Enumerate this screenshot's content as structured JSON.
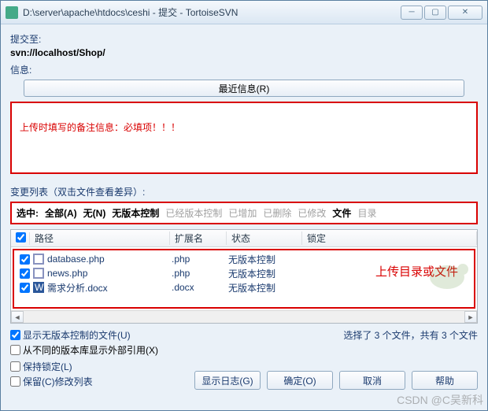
{
  "window": {
    "title": "D:\\server\\apache\\htdocs\\ceshi - 提交 - TortoiseSVN"
  },
  "commit_to_label": "提交至:",
  "commit_url": "svn://localhost/Shop/",
  "info_label": "信息:",
  "recent_button": "最近信息(R)",
  "message_annotation": "上传时填写的备注信息：必填项！！！",
  "changelist_label": "变更列表（双击文件查看差异）:",
  "filter": {
    "selected_label": "选中:",
    "all": "全部(A)",
    "none": "无(N)",
    "unversioned": "无版本控制",
    "versioned": "已经版本控制",
    "added": "已增加",
    "deleted": "已删除",
    "modified": "已修改",
    "files": "文件",
    "dirs": "目录"
  },
  "columns": {
    "path": "路径",
    "ext": "扩展名",
    "status": "状态",
    "lock": "锁定"
  },
  "rows": [
    {
      "checked": true,
      "icon": "php",
      "name": "database.php",
      "ext": ".php",
      "status": "无版本控制"
    },
    {
      "checked": true,
      "icon": "php",
      "name": "news.php",
      "ext": ".php",
      "status": "无版本控制"
    },
    {
      "checked": true,
      "icon": "docx",
      "name": "需求分析.docx",
      "ext": ".docx",
      "status": "无版本控制"
    }
  ],
  "file_annotation": "上传目录或文件",
  "checkboxes": {
    "show_unversioned": "显示无版本控制的文件(U)",
    "show_externals": "从不同的版本库显示外部引用(X)",
    "keep_lock": "保持锁定(L)",
    "keep_changelist": "保留(C)修改列表"
  },
  "status_text": "选择了 3 个文件，共有 3 个文件",
  "buttons": {
    "showlog": "显示日志(G)",
    "ok": "确定(O)",
    "cancel": "取消",
    "help": "帮助"
  },
  "watermark": "CSDN @C吴新科"
}
